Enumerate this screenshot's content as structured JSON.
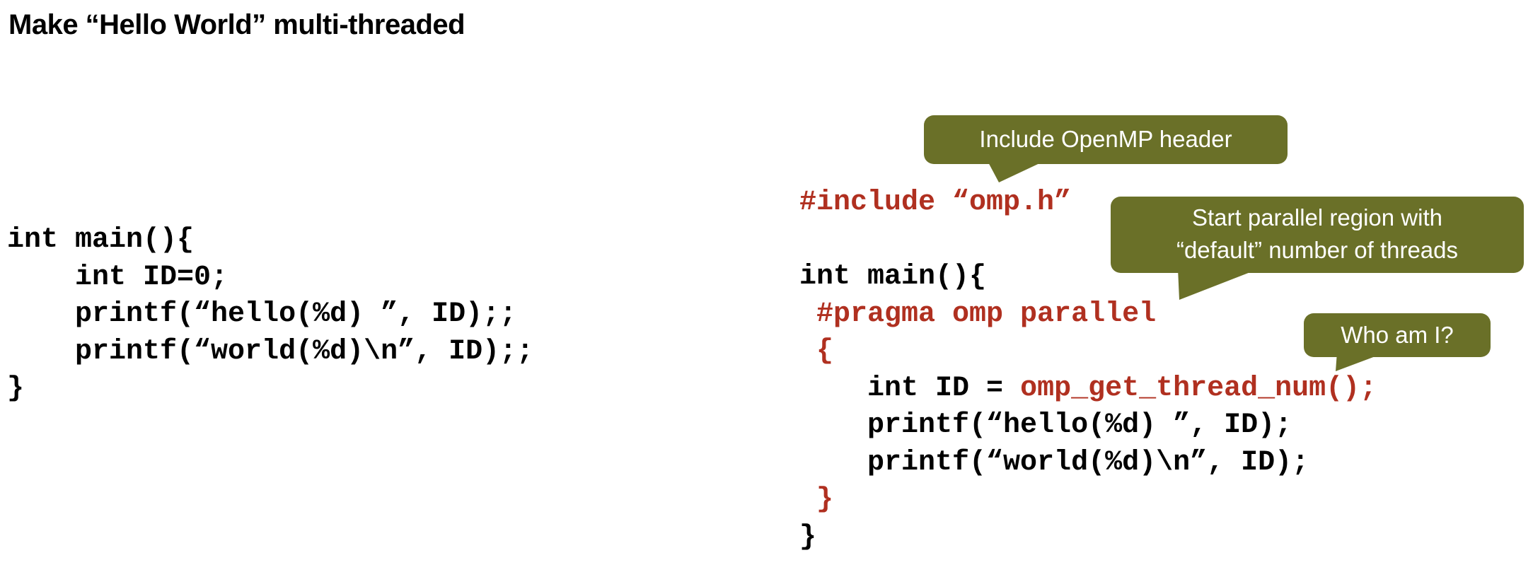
{
  "slide": {
    "title": "Make “Hello World” multi-threaded"
  },
  "left_code": {
    "lines": [
      "int main(){",
      "    int ID=0;",
      "    printf(“hello(%d) ”, ID);;",
      "    printf(“world(%d)\\n”, ID);;",
      "}"
    ]
  },
  "right_code": {
    "include_line": "#include “omp.h”",
    "main_line": "int main(){",
    "pragma_line": " #pragma omp parallel",
    "open_brace": " {",
    "id_decl_prefix": "    int ID = ",
    "id_decl_call": "omp_get_thread_num();",
    "printf_hello": "    printf(“hello(%d) ”, ID);",
    "printf_world": "    printf(“world(%d)\\n”, ID);",
    "close_brace": " }",
    "close_main": "}"
  },
  "callouts": {
    "include": "Include OpenMP header",
    "parallel_line1": "Start parallel region with",
    "parallel_line2": "“default” number of threads",
    "who": "Who am I?"
  },
  "colors": {
    "keyword_red": "#b03020",
    "callout_green": "#6a7028",
    "text": "#000000"
  }
}
